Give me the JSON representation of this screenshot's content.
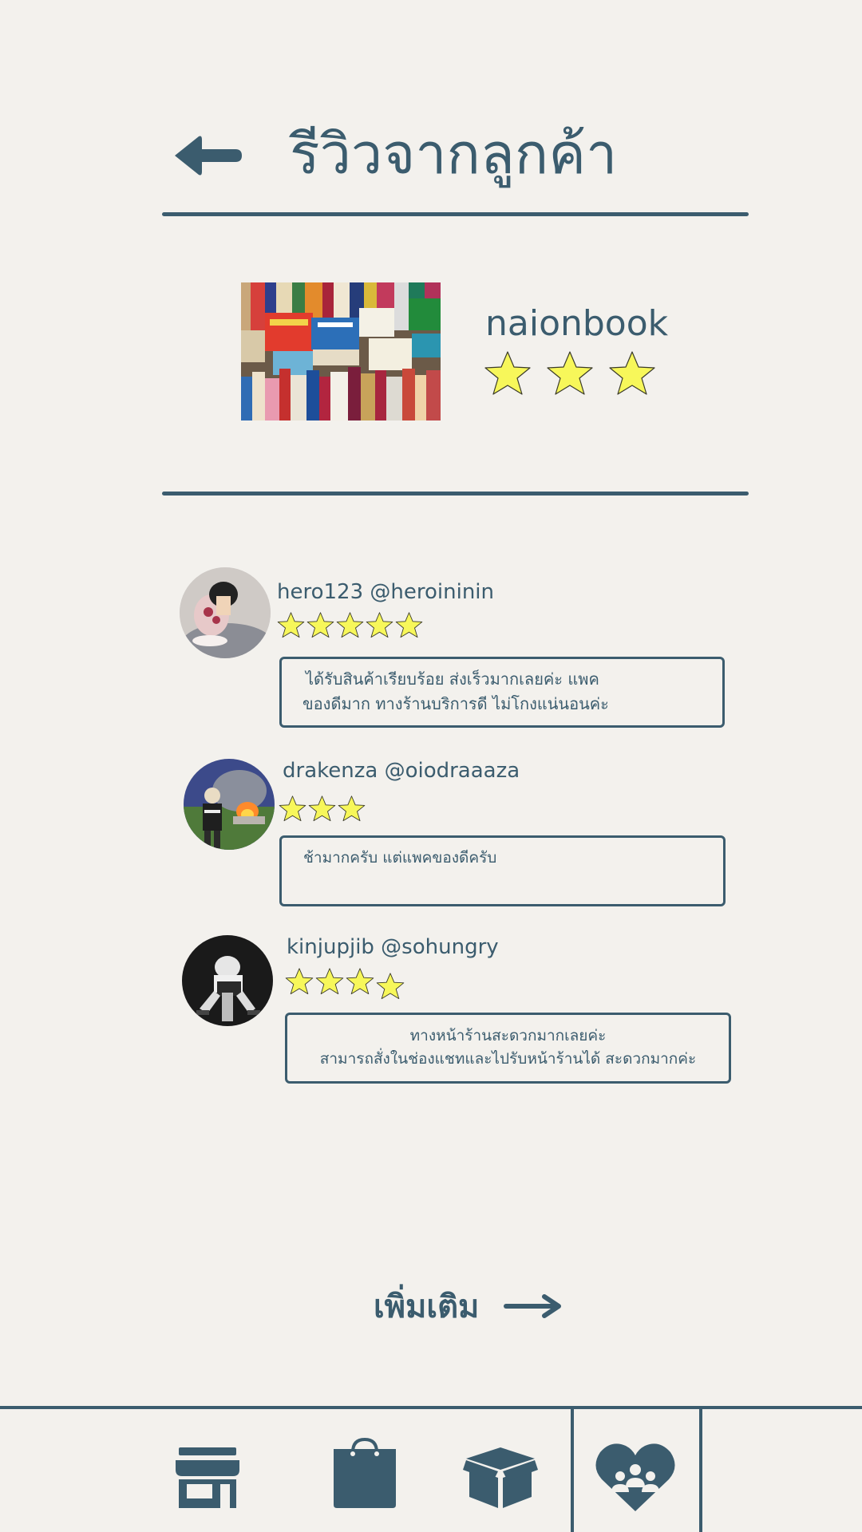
{
  "header": {
    "title": "รีวิวจากลูกค้า",
    "back_icon": "arrow-left-icon"
  },
  "shop": {
    "name": "naionbook",
    "rating": 3,
    "image_description_icon": "bookshelf-photo"
  },
  "reviews": [
    {
      "user": "hero123 @heroininin",
      "rating": 5,
      "comment_line1": "ได้รับสินค้าเรียบร้อย ส่งเร็วมากเลยค่ะ แพค",
      "comment_line2": "ของดีมาก ทางร้านบริการดี ไม่โกงแน่นอนค่ะ"
    },
    {
      "user": "drakenza @oiodraaaza",
      "rating": 3,
      "comment_line1": "ช้ามากครับ แต่แพคของดีครับ",
      "comment_line2": ""
    },
    {
      "user": "kinjupjib @sohungry",
      "rating": 4,
      "comment_line1": "ทางหน้าร้านสะดวกมากเลยค่ะ",
      "comment_line2": "สามารถสั่งในช่องแชทและไปรับหน้าร้านได้ สะดวกมากค่ะ"
    }
  ],
  "more": {
    "label": "เพิ่มเติม",
    "icon": "arrow-right-icon"
  },
  "bottom_nav": {
    "items": [
      {
        "icon": "storefront-icon"
      },
      {
        "icon": "shopping-bag-icon"
      },
      {
        "icon": "package-box-icon"
      },
      {
        "icon": "heart-community-icon",
        "active": true
      }
    ]
  },
  "colors": {
    "primary": "#3b5c6e",
    "background": "#f3f1ed",
    "star_fill": "#f7f75a"
  }
}
